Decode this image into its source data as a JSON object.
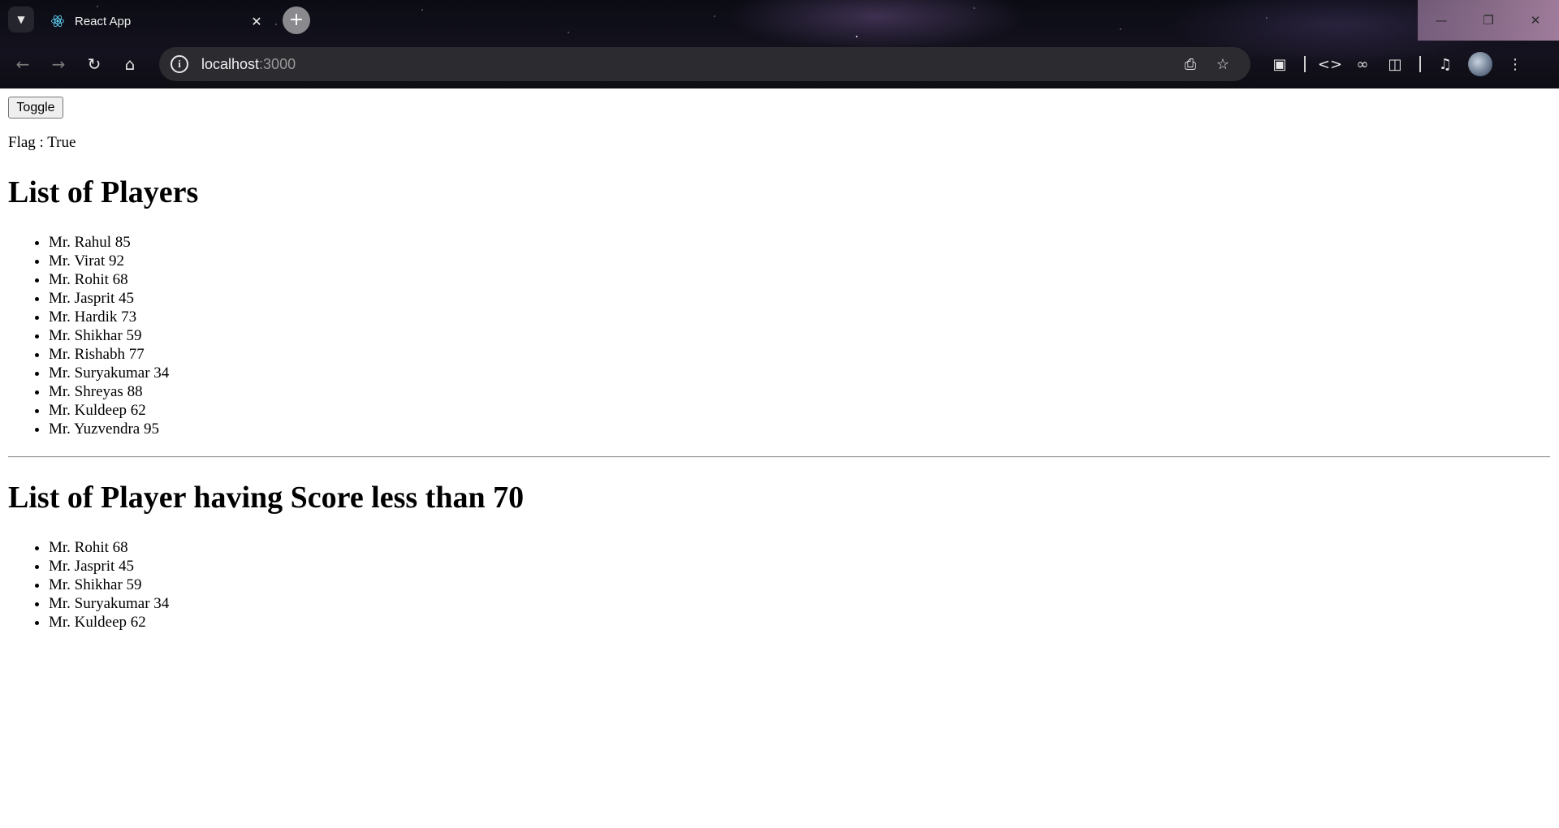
{
  "browser": {
    "tab_title": "React App",
    "url_host": "localhost",
    "url_port": ":3000"
  },
  "page": {
    "toggle_label": "Toggle",
    "flag_text": "Flag : True",
    "all_players_heading": "List of Players",
    "all_players": [
      "Mr. Rahul 85",
      "Mr. Virat 92",
      "Mr. Rohit 68",
      "Mr. Jasprit 45",
      "Mr. Hardik 73",
      "Mr. Shikhar 59",
      "Mr. Rishabh 77",
      "Mr. Suryakumar 34",
      "Mr. Shreyas 88",
      "Mr. Kuldeep 62",
      "Mr. Yuzvendra 95"
    ],
    "low_score_heading": "List of Player having Score less than 70",
    "low_score_players": [
      "Mr. Rohit 68",
      "Mr. Jasprit 45",
      "Mr. Shikhar 59",
      "Mr. Suryakumar 34",
      "Mr. Kuldeep 62"
    ]
  },
  "icons": {
    "tab_list": "chevron-down-icon",
    "favicon": "react-logo-icon",
    "tab_close": "close-icon",
    "new_tab": "plus-icon",
    "back": "arrow-left-icon",
    "forward": "arrow-right-icon",
    "reload": "reload-icon",
    "home": "home-icon",
    "site_info": "info-icon",
    "install": "install-app-icon",
    "bookmark": "star-icon",
    "extensions": "puzzle-icon",
    "devtools": "code-icon",
    "link": "link-icon",
    "translate": "translate-icon",
    "media": "media-queue-icon",
    "menu": "kebab-menu-icon"
  },
  "colors": {
    "tab_text": "#f1f1f1",
    "omnibox_bg": "#2b2b30",
    "port_text": "#9a9a9a"
  }
}
